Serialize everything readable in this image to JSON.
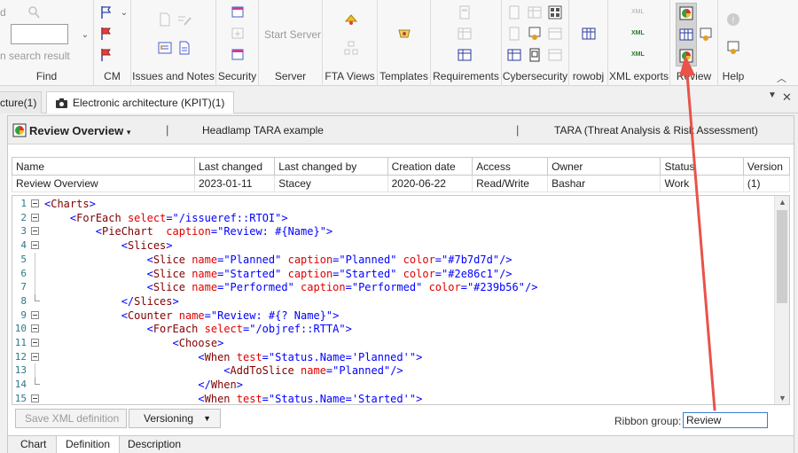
{
  "ribbon": {
    "groups": [
      {
        "id": "find",
        "label": "Find"
      },
      {
        "id": "cm",
        "label": "CM"
      },
      {
        "id": "issues",
        "label": "Issues and Notes"
      },
      {
        "id": "security",
        "label": "Security"
      },
      {
        "id": "server",
        "label": "Server"
      },
      {
        "id": "fta",
        "label": "FTA Views"
      },
      {
        "id": "templates",
        "label": "Templates"
      },
      {
        "id": "requirements",
        "label": "Requirements"
      },
      {
        "id": "cybersecurity",
        "label": "Cybersecurity"
      },
      {
        "id": "rowobj",
        "label": "rowobj"
      },
      {
        "id": "xml",
        "label": "XML exports"
      },
      {
        "id": "review",
        "label": "Review"
      },
      {
        "id": "help",
        "label": "Help"
      }
    ],
    "find_search_result": "n search result",
    "find_top_text": "d",
    "server_start": "Start Server",
    "xml_label": "XML"
  },
  "doc_tabs": [
    {
      "label": "cture(1)"
    },
    {
      "label": "Electronic architecture (KPIT)(1)"
    }
  ],
  "header": {
    "title": "Review Overview",
    "dropdown_glyph": "▾",
    "project": "Headlamp TARA example",
    "model": "TARA (Threat Analysis & Risk Assessment)",
    "separator": "|"
  },
  "meta_table": {
    "headers": [
      "Name",
      "Last changed",
      "Last changed by",
      "Creation date",
      "Access",
      "Owner",
      "Status",
      "Version"
    ],
    "row": [
      "Review Overview",
      "2023-01-11",
      "Stacey",
      "2020-06-22",
      "Read/Write",
      "Bashar",
      "Work",
      "(1)"
    ]
  },
  "code_lines": [
    {
      "n": "1",
      "fold": "box",
      "text": "<Charts>"
    },
    {
      "n": "2",
      "fold": "box",
      "text": "    <ForEach select=\"/issueref::RTOI\">"
    },
    {
      "n": "3",
      "fold": "box",
      "text": "        <PieChart  caption=\"Review: #{Name}\">"
    },
    {
      "n": "4",
      "fold": "box",
      "text": "            <Slices>"
    },
    {
      "n": "5",
      "fold": "rail",
      "text": "                <Slice name=\"Planned\" caption=\"Planned\" color=\"#7b7d7d\"/>"
    },
    {
      "n": "6",
      "fold": "rail",
      "text": "                <Slice name=\"Started\" caption=\"Started\" color=\"#2e86c1\"/>"
    },
    {
      "n": "7",
      "fold": "rail",
      "text": "                <Slice name=\"Performed\" caption=\"Performed\" color=\"#239b56\"/>"
    },
    {
      "n": "8",
      "fold": "end",
      "text": "            </Slices>"
    },
    {
      "n": "9",
      "fold": "box",
      "text": "            <Counter name=\"Review: #{? Name}\">"
    },
    {
      "n": "10",
      "fold": "box",
      "text": "                <ForEach select=\"/objref::RTTA\">"
    },
    {
      "n": "11",
      "fold": "box",
      "text": "                    <Choose>"
    },
    {
      "n": "12",
      "fold": "box",
      "text": "                        <When test=\"Status.Name='Planned'\">"
    },
    {
      "n": "13",
      "fold": "rail",
      "text": "                            <AddToSlice name=\"Planned\"/>"
    },
    {
      "n": "14",
      "fold": "end",
      "text": "                        </When>"
    },
    {
      "n": "15",
      "fold": "box",
      "text": "                        <When test=\"Status.Name='Started'\">"
    }
  ],
  "bottom": {
    "save_xml": "Save XML definition",
    "versioning": "Versioning",
    "ribbon_group_label": "Ribbon group:",
    "ribbon_group_value": "Review"
  },
  "bottom_tabs": [
    "Chart",
    "Definition",
    "Description"
  ],
  "colors": {
    "annotation_arrow": "#e8534a",
    "accent": "#3a7bd5"
  }
}
